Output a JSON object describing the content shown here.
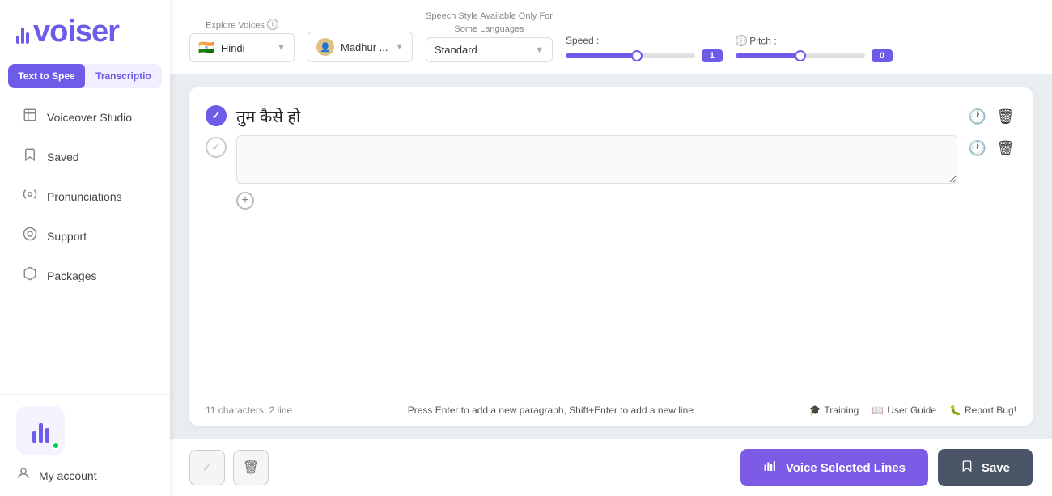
{
  "sidebar": {
    "logo": "voiser",
    "tabs": [
      {
        "label": "Text to Spee",
        "active": true
      },
      {
        "label": "Transcriptio",
        "active": false
      }
    ],
    "nav_items": [
      {
        "icon": "🎙",
        "label": "Voiceover Studio",
        "name": "voiceover-studio"
      },
      {
        "icon": "🔖",
        "label": "Saved",
        "name": "saved"
      },
      {
        "icon": "⚙️",
        "label": "Pronunciations",
        "name": "pronunciations"
      },
      {
        "icon": "🔘",
        "label": "Support",
        "name": "support"
      },
      {
        "icon": "📦",
        "label": "Packages",
        "name": "packages"
      }
    ],
    "my_account": "My account"
  },
  "controls": {
    "explore_voices_label": "Explore Voices",
    "speech_style_label": "Speech Style Available Only For",
    "speech_style_sublabel": "Some Languages",
    "language": "Hindi",
    "voice": "Madhur ...",
    "style": "Standard",
    "speed_label": "Speed :",
    "speed_value": "1",
    "speed_fill_pct": 55,
    "speed_thumb_pct": 55,
    "pitch_label": "Pitch :",
    "pitch_value": "0",
    "pitch_fill_pct": 50,
    "pitch_thumb_pct": 50
  },
  "editor": {
    "line1": {
      "text": "तुम कैसे हो",
      "checked": true
    },
    "line2": {
      "text": "",
      "checked": false,
      "placeholder": ""
    },
    "char_count": "11 characters, 2 line",
    "hint": "Press Enter to add a new paragraph, Shift+Enter to add a new line",
    "footer_links": [
      {
        "icon": "🎓",
        "label": "Training"
      },
      {
        "icon": "📖",
        "label": "User Guide"
      },
      {
        "icon": "🐛",
        "label": "Report Bug!"
      }
    ]
  },
  "bottom_bar": {
    "voice_btn": "Voice Selected Lines",
    "save_btn": "Save"
  }
}
